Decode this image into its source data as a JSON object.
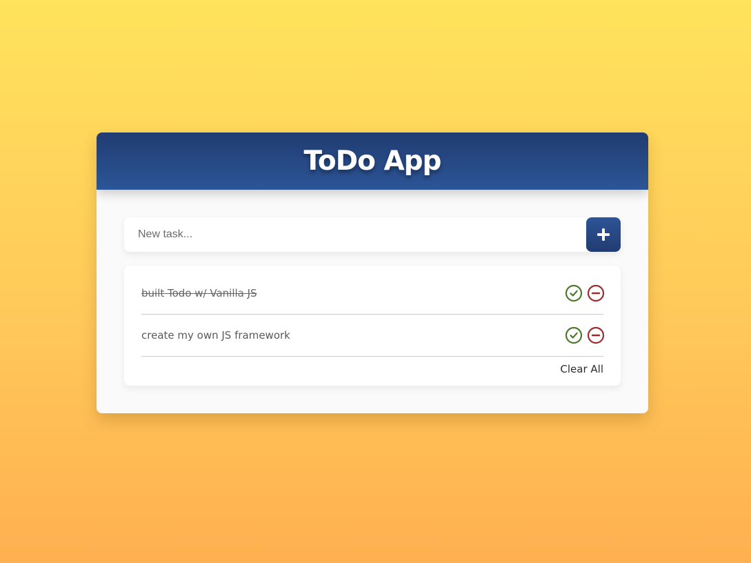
{
  "header": {
    "title": "ToDo App"
  },
  "input": {
    "placeholder": "New task...",
    "value": ""
  },
  "add_button": {
    "icon": "plus-icon"
  },
  "tasks": [
    {
      "text": "built Todo w/ Vanilla JS",
      "completed": true
    },
    {
      "text": "create my own JS framework",
      "completed": false
    }
  ],
  "footer": {
    "clear_label": "Clear All"
  },
  "colors": {
    "header_blue": "#2c5597",
    "complete_green": "#4b7a2a",
    "remove_red": "#9b2c2c",
    "background_top": "#ffe35c",
    "background_bottom": "#ffb050"
  }
}
